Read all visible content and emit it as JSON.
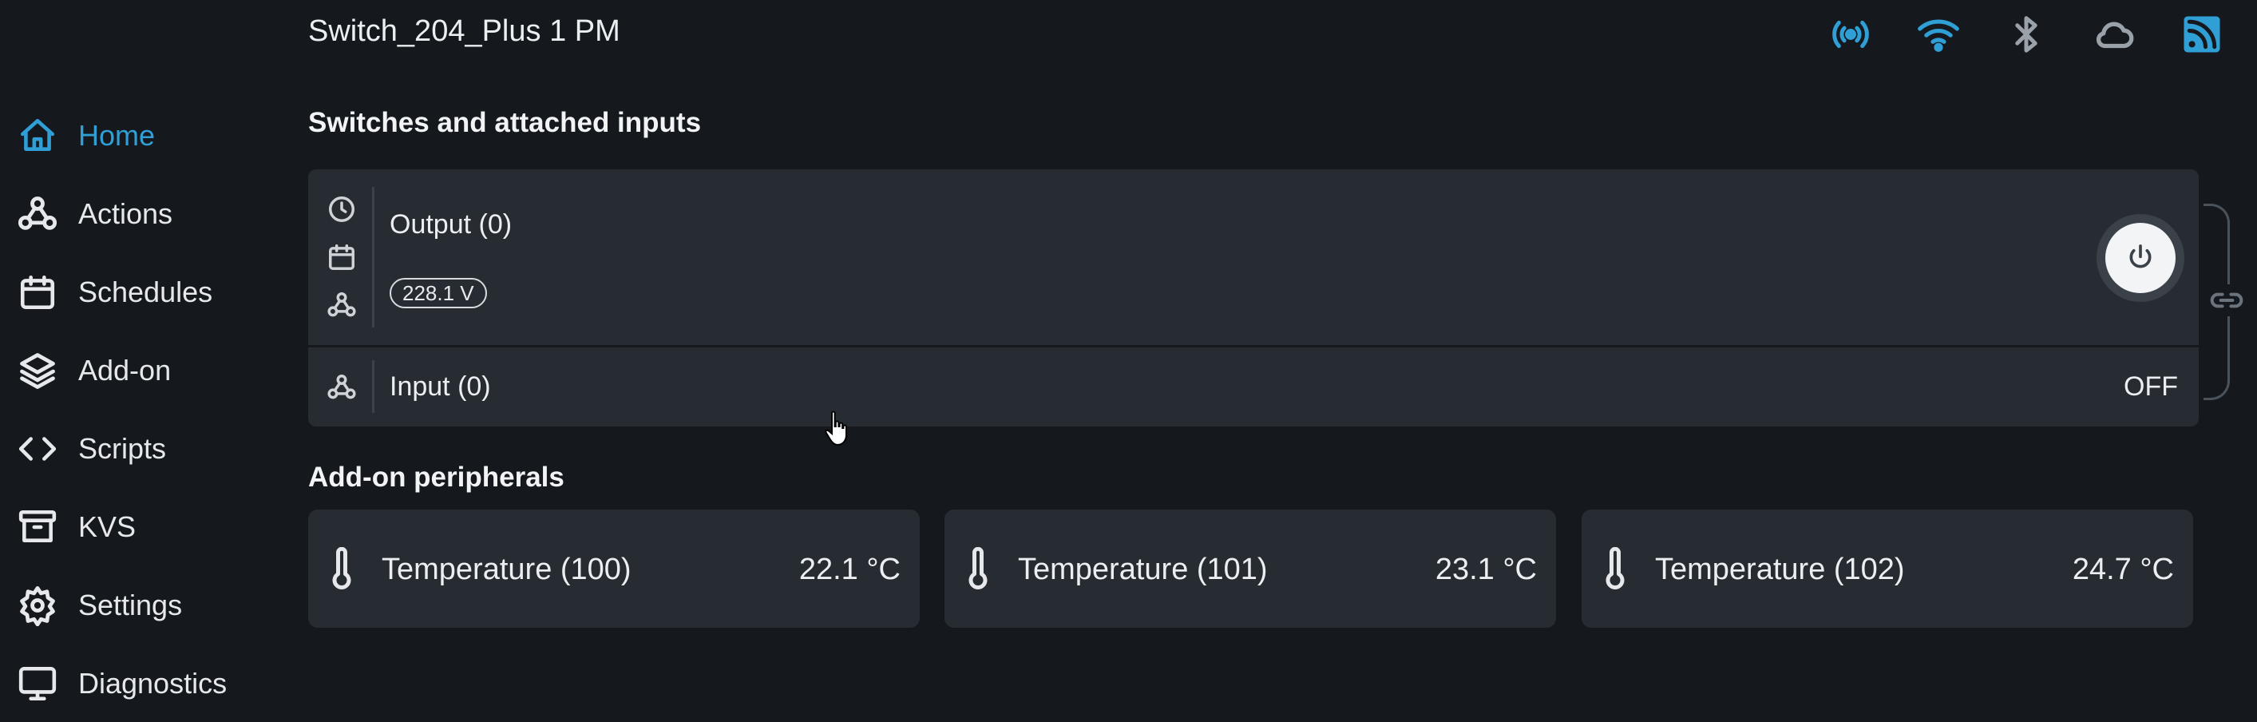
{
  "header": {
    "device_name": "Switch_204_Plus 1 PM",
    "status_icons": [
      "radio-broadcast-icon",
      "wifi-icon",
      "bluetooth-icon",
      "cloud-icon",
      "rss-feed-icon"
    ]
  },
  "sidebar": {
    "items": [
      {
        "label": "Home",
        "icon": "home-icon",
        "active": true
      },
      {
        "label": "Actions",
        "icon": "webhook-icon"
      },
      {
        "label": "Schedules",
        "icon": "calendar-icon"
      },
      {
        "label": "Add-on",
        "icon": "layers-icon"
      },
      {
        "label": "Scripts",
        "icon": "code-icon"
      },
      {
        "label": "KVS",
        "icon": "archive-icon"
      },
      {
        "label": "Settings",
        "icon": "gear-icon"
      },
      {
        "label": "Diagnostics",
        "icon": "monitor-icon"
      }
    ]
  },
  "switches": {
    "title": "Switches and attached inputs",
    "output": {
      "name": "Output (0)",
      "voltage": "228.1 V"
    },
    "input": {
      "name": "Input (0)",
      "state": "OFF"
    }
  },
  "peripherals": {
    "title": "Add-on peripherals",
    "items": [
      {
        "name": "Temperature (100)",
        "value": "22.1 °C"
      },
      {
        "name": "Temperature (101)",
        "value": "23.1 °C"
      },
      {
        "name": "Temperature (102)",
        "value": "24.7 °C"
      }
    ]
  },
  "colors": {
    "accent": "#2f9fd6",
    "background": "#15191e",
    "card": "#272c33"
  }
}
